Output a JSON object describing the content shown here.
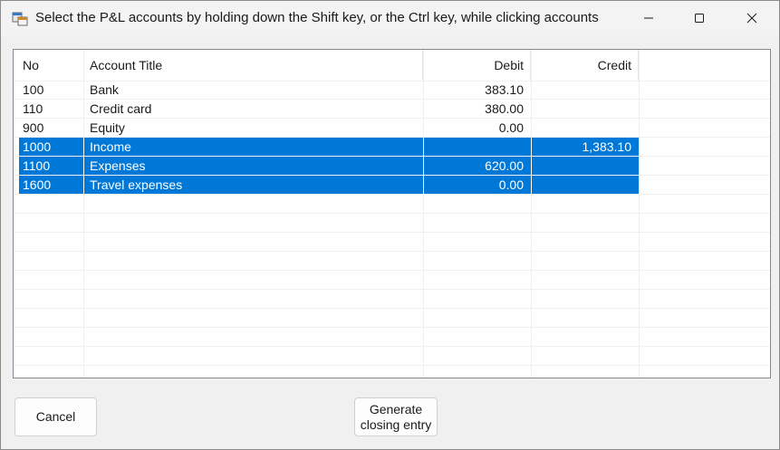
{
  "window": {
    "title": "Select the P&L accounts by holding down the Shift key, or the Ctrl key, while clicking accounts",
    "icons": {
      "app": "app-form-icon",
      "minimize": "minimize-icon",
      "maximize": "maximize-icon",
      "close": "close-icon"
    }
  },
  "table": {
    "columns": [
      "No",
      "Account Title",
      "Debit",
      "Credit"
    ],
    "rows": [
      {
        "no": "100",
        "title": "Bank",
        "debit": "383.10",
        "credit": "",
        "selected": false
      },
      {
        "no": "110",
        "title": "Credit card",
        "debit": "380.00",
        "credit": "",
        "selected": false
      },
      {
        "no": "900",
        "title": "Equity",
        "debit": "0.00",
        "credit": "",
        "selected": false
      },
      {
        "no": "1000",
        "title": "Income",
        "debit": "",
        "credit": "1,383.10",
        "selected": true
      },
      {
        "no": "1100",
        "title": "Expenses",
        "debit": "620.00",
        "credit": "",
        "selected": true
      },
      {
        "no": "1600",
        "title": "Travel expenses",
        "debit": "0.00",
        "credit": "",
        "selected": true
      }
    ],
    "selection_color": "#0078d7"
  },
  "buttons": {
    "cancel": "Cancel",
    "generate": "Generate\nclosing entry"
  }
}
